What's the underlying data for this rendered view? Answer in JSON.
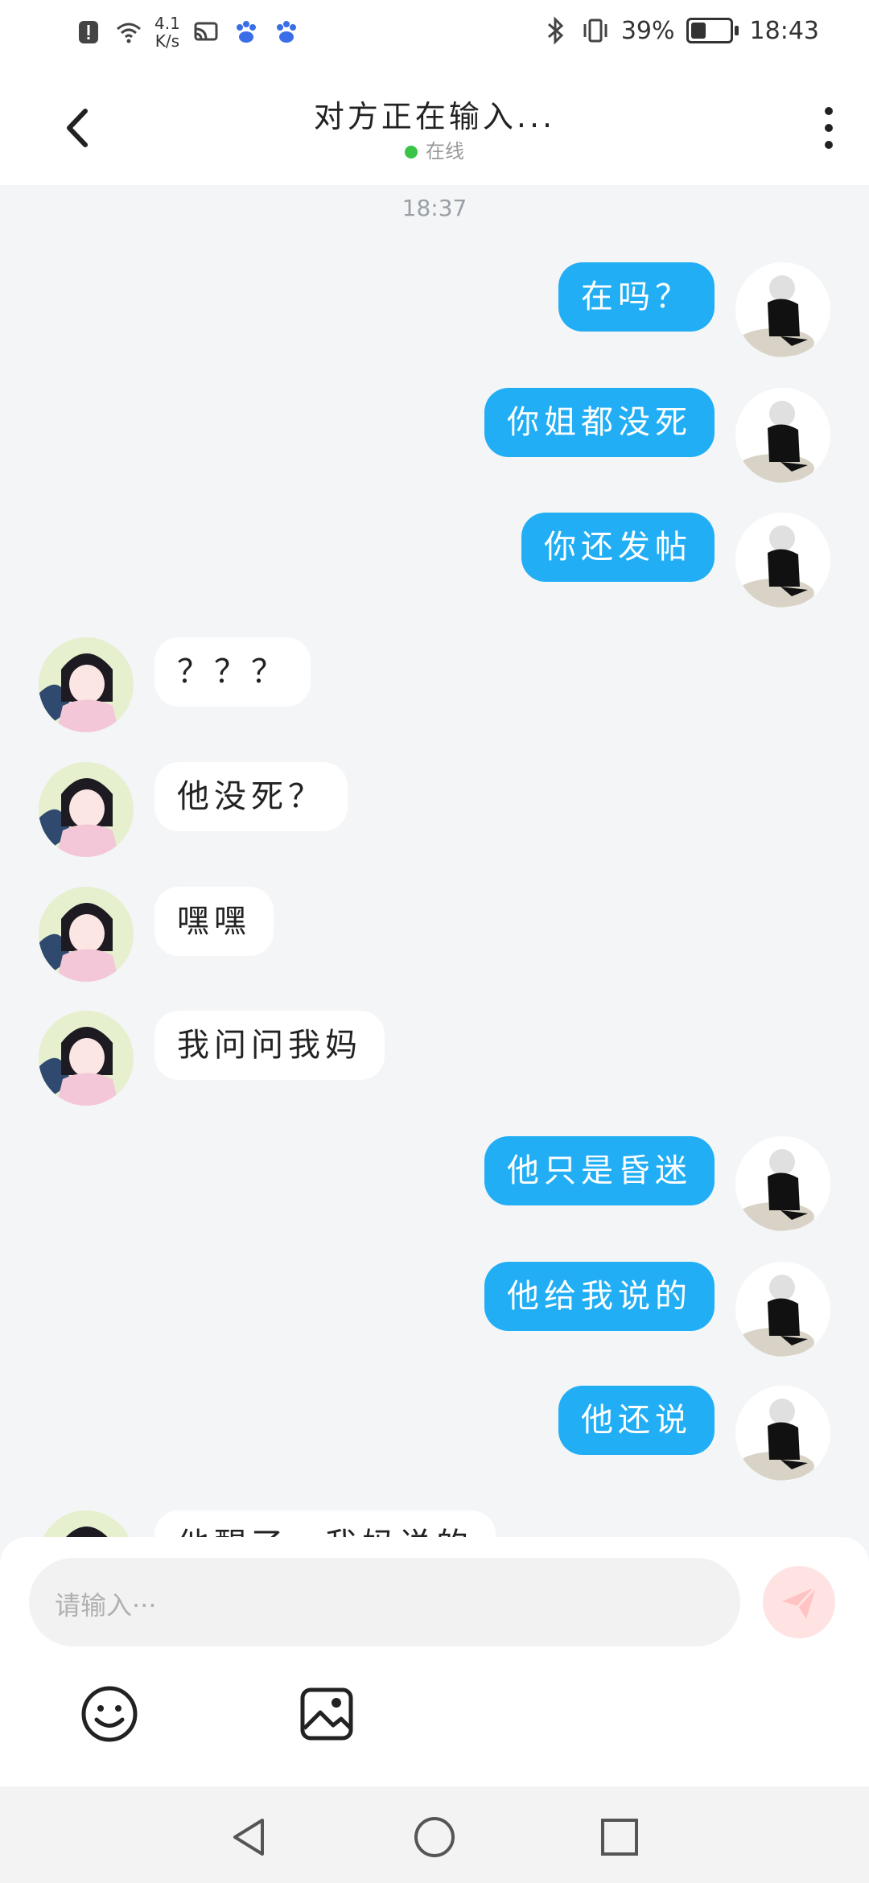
{
  "status_bar": {
    "network_speed": "4.1\nK/s",
    "battery_percent": "39%",
    "time": "18:43",
    "icons": [
      "alert-icon",
      "wifi-icon",
      "cast-icon",
      "baidu-paw-icon",
      "baidu-paw-icon",
      "bluetooth-icon",
      "vibrate-icon",
      "battery-icon"
    ]
  },
  "header": {
    "title": "对方正在输入...",
    "status": "在线"
  },
  "chat": {
    "timestamp": "18:37",
    "messages": [
      {
        "side": "me",
        "text": "在吗？"
      },
      {
        "side": "me",
        "text": "你姐都没死"
      },
      {
        "side": "me",
        "text": "你还发帖"
      },
      {
        "side": "other",
        "text": "？？？"
      },
      {
        "side": "other",
        "text": "他没死？"
      },
      {
        "side": "other",
        "text": "嘿嘿"
      },
      {
        "side": "other",
        "text": "我问问我妈"
      },
      {
        "side": "me",
        "text": "他只是昏迷"
      },
      {
        "side": "me",
        "text": "他给我说的"
      },
      {
        "side": "me",
        "text": "他还说"
      },
      {
        "side": "other",
        "text": "他醒了，我妈说的"
      }
    ]
  },
  "composer": {
    "placeholder": "请输入···",
    "send_color": "#ffe3e3"
  },
  "colors": {
    "accent": "#21aef5",
    "online": "#37c447"
  }
}
